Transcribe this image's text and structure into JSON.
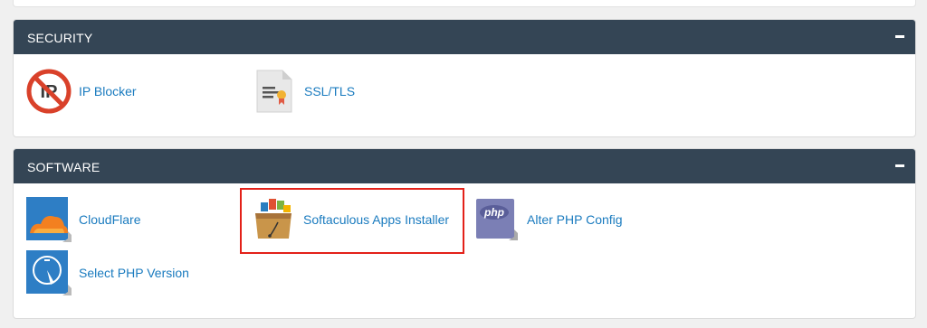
{
  "sections": {
    "security": {
      "title": "SECURITY",
      "items": [
        {
          "label": "IP Blocker",
          "icon": "ip-blocker-icon"
        },
        {
          "label": "SSL/TLS",
          "icon": "ssl-tls-certificate-icon"
        }
      ]
    },
    "software": {
      "title": "SOFTWARE",
      "items": [
        {
          "label": "CloudFlare",
          "icon": "cloudflare-icon"
        },
        {
          "label": "Softaculous Apps Installer",
          "icon": "softaculous-toolbox-icon"
        },
        {
          "label": "Alter PHP Config",
          "icon": "php-config-icon"
        },
        {
          "label": "Select PHP Version",
          "icon": "php-version-gauge-icon"
        }
      ]
    }
  },
  "icon_text": {
    "ip_blocker": "IP",
    "php": "php"
  },
  "colors": {
    "header_bg": "#344555",
    "link": "#1a7bbf",
    "highlight": "#e32119",
    "ip_blocker_red": "#d9412a",
    "cloudflare_orange": "#f38020",
    "php_purple": "#7b7fb5"
  }
}
